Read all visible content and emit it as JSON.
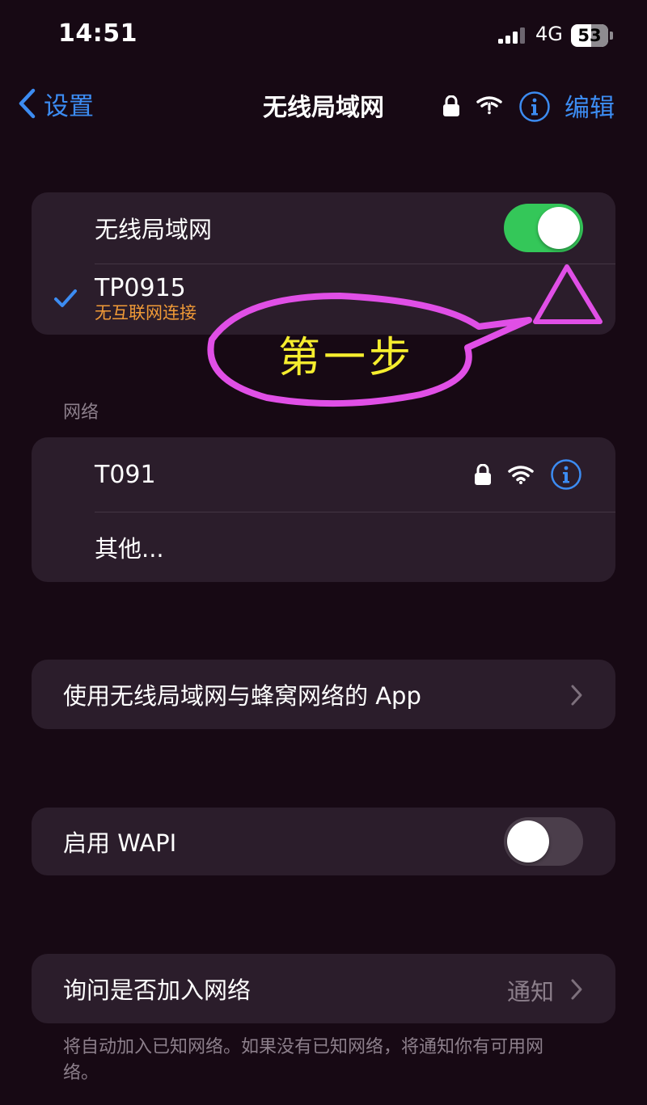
{
  "status_bar": {
    "time": "14:51",
    "network": "4G",
    "battery": "53"
  },
  "nav": {
    "back_label": "设置",
    "title": "无线局域网",
    "edit_label": "编辑"
  },
  "wifi_card": {
    "toggle_label": "无线局域网",
    "toggle_on": true,
    "connected_network": {
      "name": "TP0915",
      "status": "无互联网连接"
    }
  },
  "networks": {
    "header": "网络",
    "items": [
      {
        "name": "T091"
      }
    ],
    "other_label": "其他..."
  },
  "apps_row": {
    "label": "使用无线局域网与蜂窝网络的 App"
  },
  "wapi_row": {
    "label": "启用 WAPI",
    "toggle_on": false
  },
  "ask_join": {
    "label": "询问是否加入网络",
    "value": "通知"
  },
  "footer_text": "将自动加入已知网络。如果没有已知网络，将通知你有可用网络。",
  "annotation": {
    "text": "第一步",
    "color": "#f6ee2e",
    "stroke": "#e04fe6"
  },
  "colors": {
    "accent": "#3c8cf2",
    "toggle_on": "#34c759",
    "warning": "#f09a37",
    "background": "#170914",
    "card": "#2b1d2b"
  }
}
